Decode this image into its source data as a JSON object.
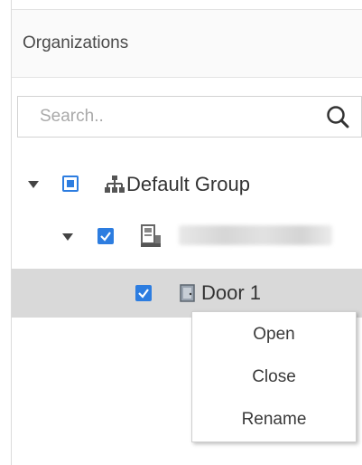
{
  "organizations": {
    "title": "Organizations"
  },
  "search": {
    "placeholder": "Search..",
    "icon": "search-icon"
  },
  "tree": {
    "root": {
      "label": "Default Group",
      "expanded": true,
      "checkbox": "partial",
      "icon": "org-tree-icon"
    },
    "device": {
      "label": "",
      "expanded": true,
      "checkbox": "checked",
      "icon": "device-icon"
    },
    "door": {
      "label": "Door 1",
      "checkbox": "checked",
      "icon": "door-icon",
      "selected": true
    }
  },
  "context_menu": {
    "items": [
      "Open",
      "Close",
      "Rename"
    ]
  },
  "colors": {
    "accent": "#2d7de0",
    "selected_row": "#d9d9d9"
  }
}
